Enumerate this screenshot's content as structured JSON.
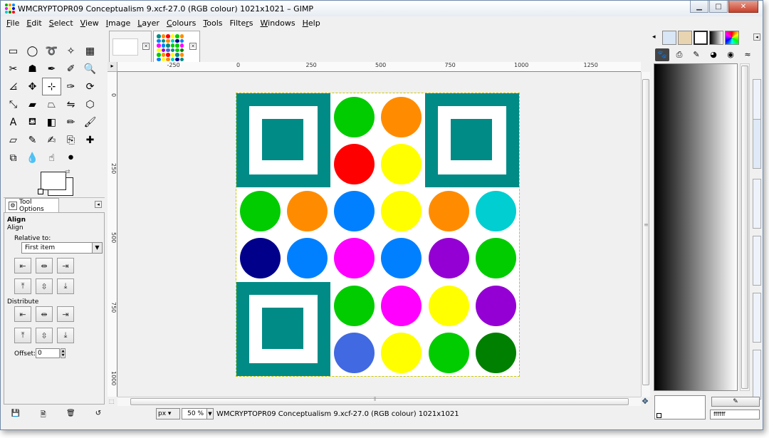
{
  "window": {
    "title": "WMCRYPTOPR09 Conceptualism 9.xcf-27.0 (RGB colour) 1021x1021 – GIMP",
    "minimize": "▁",
    "maximize": "□",
    "close": "✕"
  },
  "menubar": [
    {
      "mnemonic": "F",
      "rest": "ile"
    },
    {
      "mnemonic": "E",
      "rest": "dit"
    },
    {
      "mnemonic": "S",
      "rest": "elect"
    },
    {
      "mnemonic": "V",
      "rest": "iew"
    },
    {
      "mnemonic": "I",
      "rest": "mage"
    },
    {
      "mnemonic": "L",
      "rest": "ayer"
    },
    {
      "mnemonic": "C",
      "rest": "olours"
    },
    {
      "mnemonic": "T",
      "rest": "ools"
    },
    {
      "mnemonic": "r",
      "prefix": "Filte",
      "rest": "s"
    },
    {
      "mnemonic": "W",
      "rest": "indows"
    },
    {
      "mnemonic": "H",
      "rest": "elp"
    }
  ],
  "tools": [
    {
      "name": "rect-select-tool",
      "glyph": "▭"
    },
    {
      "name": "ellipse-select-tool",
      "glyph": "◯"
    },
    {
      "name": "free-select-tool",
      "glyph": "➰"
    },
    {
      "name": "fuzzy-select-tool",
      "glyph": "✧"
    },
    {
      "name": "color-select-tool",
      "glyph": "▦"
    },
    {
      "name": "scissors-tool",
      "glyph": "✂"
    },
    {
      "name": "foreground-select-tool",
      "glyph": "☗"
    },
    {
      "name": "paths-tool",
      "glyph": "✒"
    },
    {
      "name": "color-picker-tool",
      "glyph": "✐"
    },
    {
      "name": "zoom-tool",
      "glyph": "🔍"
    },
    {
      "name": "measure-tool",
      "glyph": "⦞"
    },
    {
      "name": "move-tool",
      "glyph": "✥"
    },
    {
      "name": "align-tool",
      "glyph": "⊹",
      "active": true
    },
    {
      "name": "crop-tool",
      "glyph": "✑"
    },
    {
      "name": "rotate-tool",
      "glyph": "⟳"
    },
    {
      "name": "scale-tool",
      "glyph": "⤡"
    },
    {
      "name": "shear-tool",
      "glyph": "▰"
    },
    {
      "name": "perspective-tool",
      "glyph": "⏢"
    },
    {
      "name": "flip-tool",
      "glyph": "⇋"
    },
    {
      "name": "cage-tool",
      "glyph": "⬡"
    },
    {
      "name": "text-tool",
      "glyph": "A"
    },
    {
      "name": "bucket-fill-tool",
      "glyph": "⛾"
    },
    {
      "name": "blend-tool",
      "glyph": "◧"
    },
    {
      "name": "pencil-tool",
      "glyph": "✏"
    },
    {
      "name": "paintbrush-tool",
      "glyph": "🖌"
    },
    {
      "name": "eraser-tool",
      "glyph": "▱"
    },
    {
      "name": "airbrush-tool",
      "glyph": "✎"
    },
    {
      "name": "ink-tool",
      "glyph": "✍"
    },
    {
      "name": "clone-tool",
      "glyph": "⎘"
    },
    {
      "name": "heal-tool",
      "glyph": "✚"
    },
    {
      "name": "perspective-clone-tool",
      "glyph": "⧉"
    },
    {
      "name": "blur-tool",
      "glyph": "💧"
    },
    {
      "name": "smudge-tool",
      "glyph": "☝"
    },
    {
      "name": "dodge-burn-tool",
      "glyph": "⚫"
    }
  ],
  "tool_options": {
    "tab_label": "Tool Options",
    "title": "Align",
    "subtitle": "Align",
    "relative_to_label": "Relative to:",
    "relative_to_value": "First item",
    "distribute_label": "Distribute",
    "offset_label": "Offset:",
    "offset_value": "0"
  },
  "image_tabs": [
    {
      "name": "blank-image"
    },
    {
      "name": "conceptualism-image",
      "active": true
    }
  ],
  "rulers": {
    "h_labels": [
      "-250",
      "0",
      "250",
      "500",
      "750",
      "1000",
      "1250"
    ],
    "v_labels": [
      "0",
      "250",
      "500",
      "750",
      "1000"
    ]
  },
  "status": {
    "unit": "px",
    "zoom": "50 %",
    "text": "WMCRYPTOPR09 Conceptualism 9.xcf-27.0 (RGB colour) 1021x1021"
  },
  "dock": {
    "hex_value": "ffffff"
  },
  "artwork": {
    "teal": "#008b87",
    "circles": [
      [
        "#00cc00",
        "#ff8c00"
      ],
      [
        "#ff0000",
        "#ffff00"
      ],
      [
        "#00cc00",
        "#ff8c00",
        "#0080ff",
        "#ffff00",
        "#ff8c00",
        "#00ced1"
      ],
      [
        "#00008b",
        "#0080ff",
        "#ff00ff",
        "#0080ff",
        "#9400d3",
        "#00cc00"
      ],
      [
        "#00cc00",
        "#ff00ff",
        "#ffff00",
        "#9400d3"
      ],
      [
        "#4169e1",
        "#ffff00",
        "#00cc00",
        "#008000"
      ]
    ]
  }
}
